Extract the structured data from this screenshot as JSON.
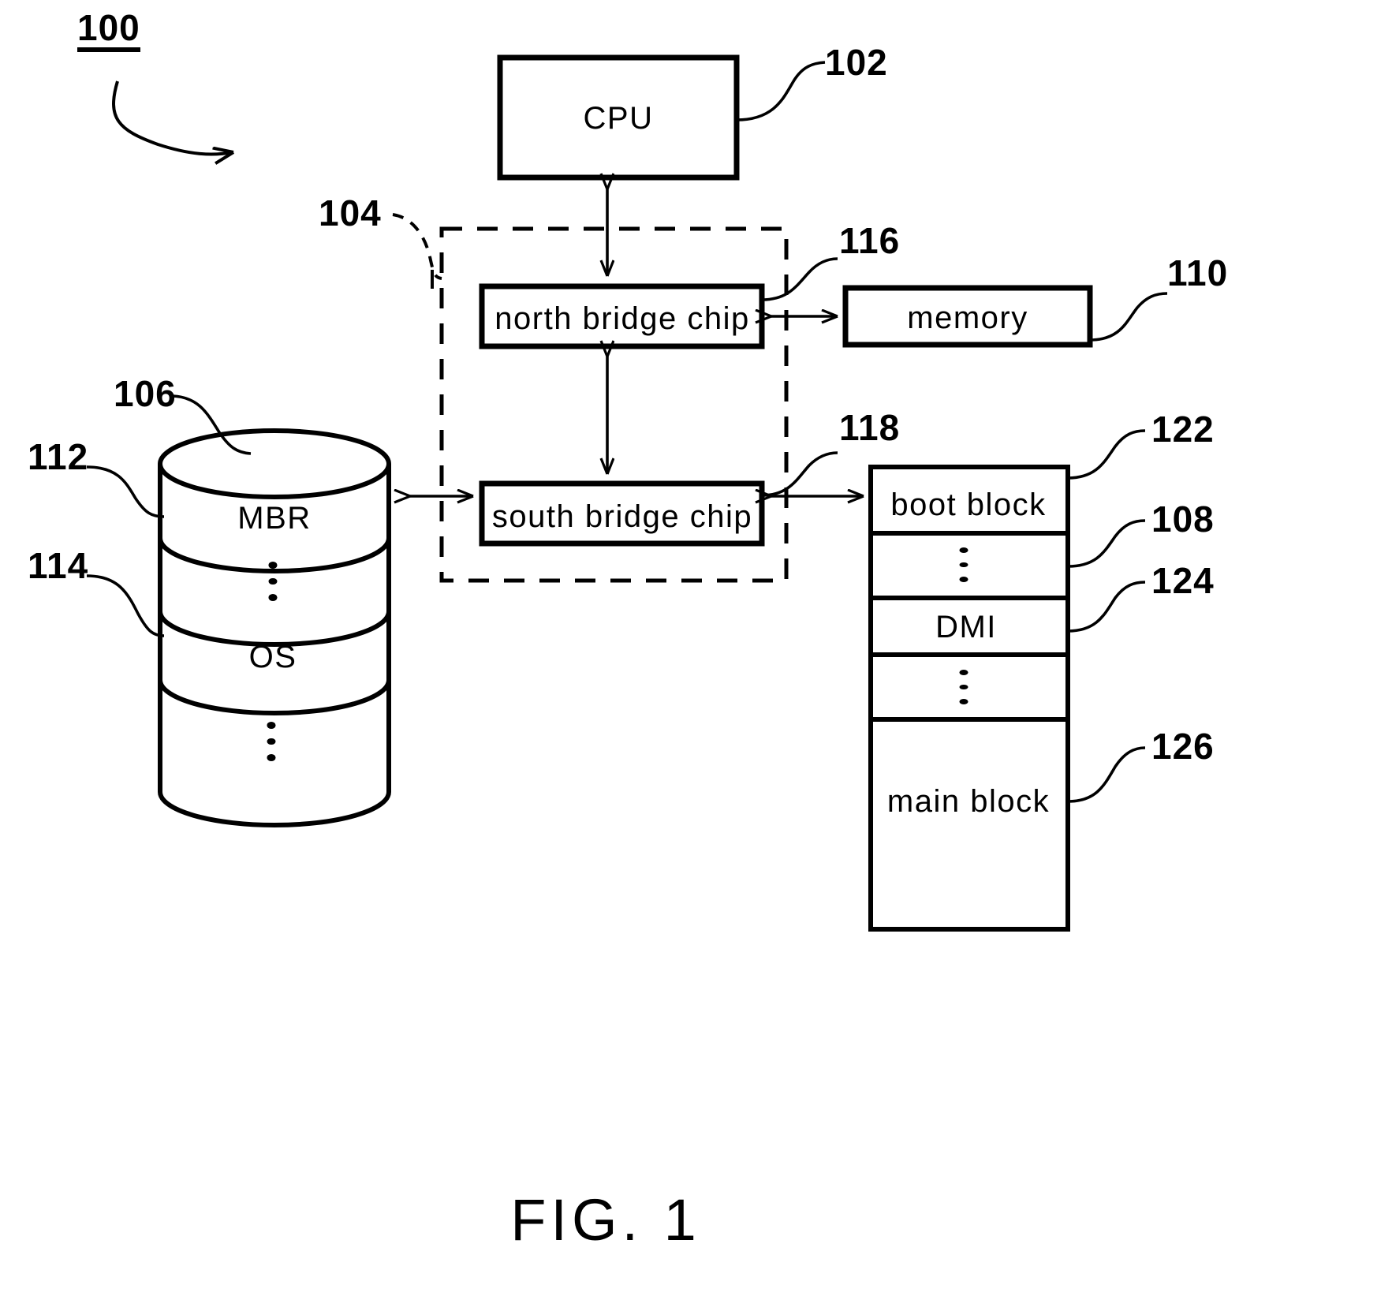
{
  "figure": {
    "caption": "FIG. 1",
    "system_ref": "100"
  },
  "blocks": {
    "cpu": {
      "label": "CPU",
      "ref": "102"
    },
    "north_bridge": {
      "label": "north  bridge  chip",
      "ref": "116"
    },
    "south_bridge": {
      "label": "south  bridge  chip",
      "ref": "118"
    },
    "memory": {
      "label": "memory",
      "ref": "110"
    },
    "chipset": {
      "ref": "104"
    }
  },
  "storage": {
    "ref": "106",
    "segments": [
      {
        "label": "MBR",
        "ref": "112"
      },
      {
        "label": "",
        "ref": ""
      },
      {
        "label": "OS",
        "ref": "114"
      },
      {
        "label": "",
        "ref": ""
      }
    ]
  },
  "flash": {
    "rows": [
      {
        "label": "boot  block",
        "ref": "122"
      },
      {
        "label": "",
        "ref": "108"
      },
      {
        "label": "DMI",
        "ref": "124"
      },
      {
        "label": "",
        "ref": ""
      },
      {
        "label": "main  block",
        "ref": "126"
      }
    ]
  },
  "refs": {
    "r100": "100",
    "r102": "102",
    "r104": "104",
    "r106": "106",
    "r108": "108",
    "r110": "110",
    "r112": "112",
    "r114": "114",
    "r116": "116",
    "r118": "118",
    "r122": "122",
    "r124": "124",
    "r126": "126"
  }
}
